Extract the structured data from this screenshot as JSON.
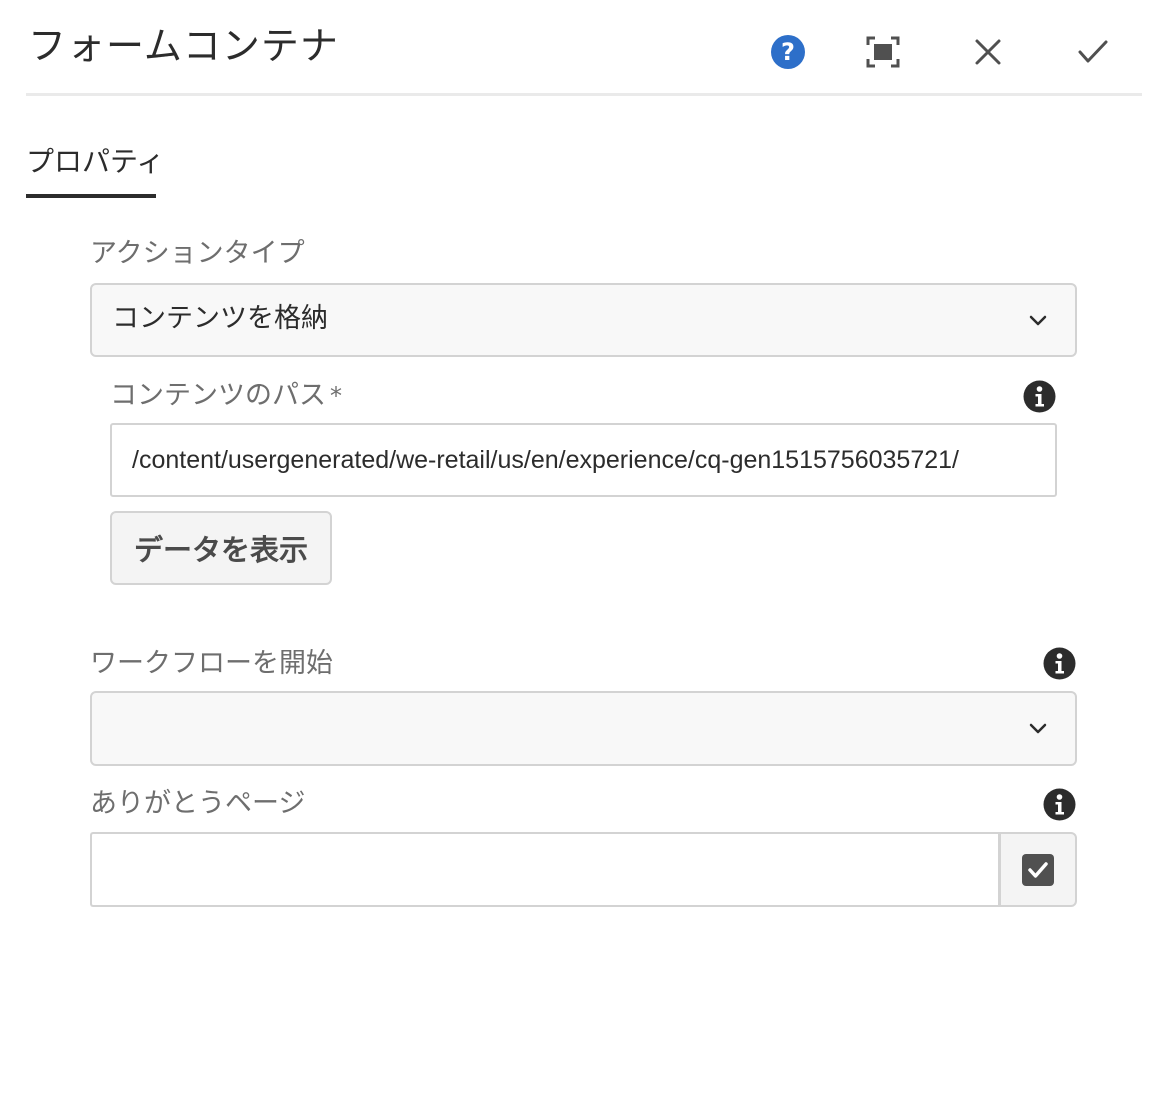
{
  "dialog": {
    "title": "フォームコンテナ"
  },
  "header_actions": {
    "help": "help-icon",
    "fullscreen": "fullscreen-icon",
    "cancel": "close-icon",
    "done": "checkmark-icon"
  },
  "tabs": [
    {
      "label": "プロパティ",
      "selected": true
    }
  ],
  "fields": {
    "action_type": {
      "label": "アクションタイプ",
      "value": "コンテンツを格納"
    },
    "content_path": {
      "label": "コンテンツのパス",
      "required_mark": "*",
      "value": "/content/usergenerated/we-retail/us/en/experience/cq-gen1515756035721/"
    },
    "view_data_button": {
      "label": "データを表示"
    },
    "start_workflow": {
      "label": "ワークフローを開始",
      "value": ""
    },
    "thank_you_page": {
      "label": "ありがとうページ",
      "value": ""
    }
  },
  "colors": {
    "help_blue": "#2d6fc9",
    "text": "#2c2c2c",
    "label": "#6e6e6e",
    "border": "#d3d3d3"
  }
}
